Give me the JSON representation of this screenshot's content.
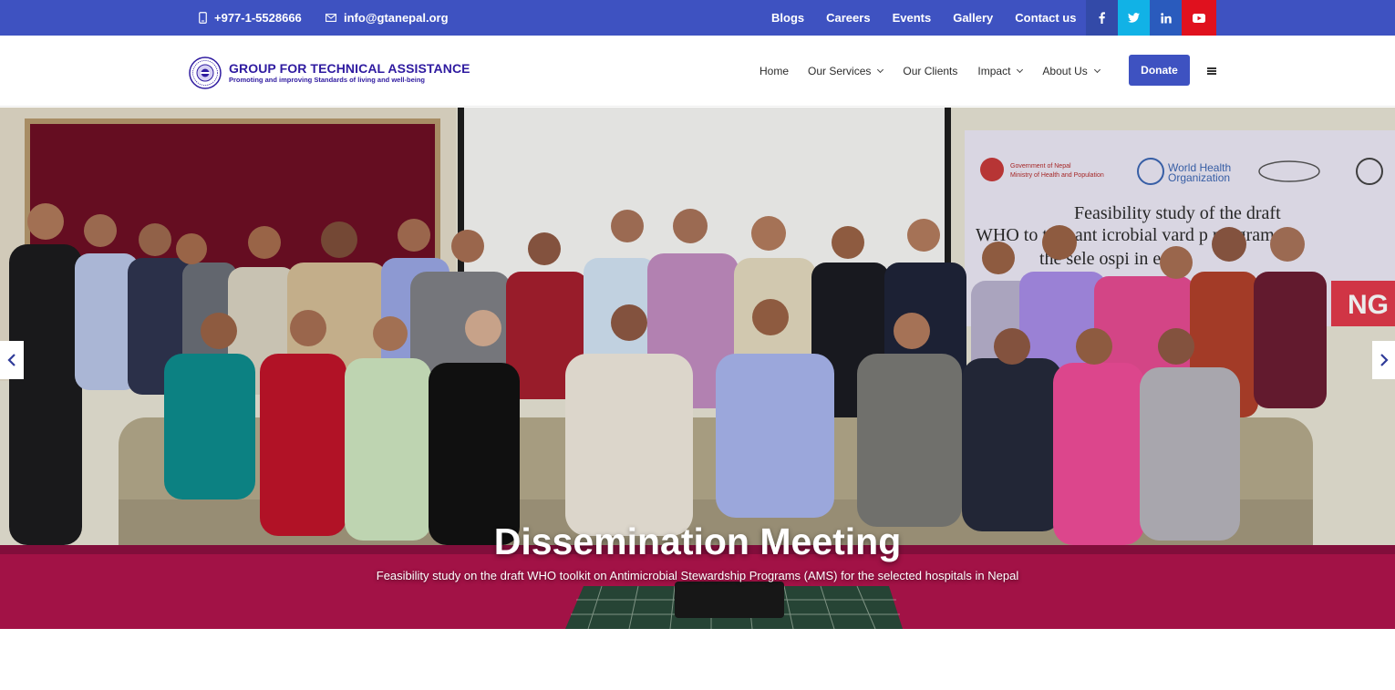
{
  "topbar": {
    "phone": "+977-1-5528666",
    "email": "info@gtanepal.org",
    "links": [
      "Blogs",
      "Careers",
      "Events",
      "Gallery",
      "Contact us"
    ],
    "social": [
      {
        "icon": "facebook-icon",
        "glyph": "f",
        "color": "#334aa8"
      },
      {
        "icon": "twitter-icon",
        "glyph": "t",
        "color": "#11b2e6"
      },
      {
        "icon": "linkedin-icon",
        "glyph": "in",
        "color": "#2a5bbd"
      },
      {
        "icon": "youtube-icon",
        "glyph": "▶",
        "color": "#e0111e"
      }
    ],
    "bg_color": "#3e52c1"
  },
  "header": {
    "logo_title": "GROUP FOR TECHNICAL ASSISTANCE",
    "logo_tagline": "Promoting and improving Standards of living and well-being",
    "nav": [
      {
        "label": "Home",
        "dropdown": false
      },
      {
        "label": "Our Services",
        "dropdown": true
      },
      {
        "label": "Our Clients",
        "dropdown": false
      },
      {
        "label": "Impact",
        "dropdown": true
      },
      {
        "label": "About Us",
        "dropdown": true
      }
    ],
    "donate_label": "Donate",
    "accent_color": "#3e52c1"
  },
  "hero": {
    "title": "Dissemination Meeting",
    "subtitle": "Feasibility study on the draft WHO toolkit on Antimicrobial Stewardship Programs (AMS) for the selected hospitals in Nepal",
    "banner_heading_line1": "Feasibility study of the draft",
    "banner_heading_line2": "WHO to   t on ant  icrobial    vard    p programs",
    "banner_heading_line3": "the sele   ospi   in  epal",
    "banner_org1": "Government of Nepal",
    "banner_org2": "Ministry of Health and Population",
    "banner_who1": "World Health",
    "banner_who2": "Organization",
    "banner_tail": "NG"
  }
}
